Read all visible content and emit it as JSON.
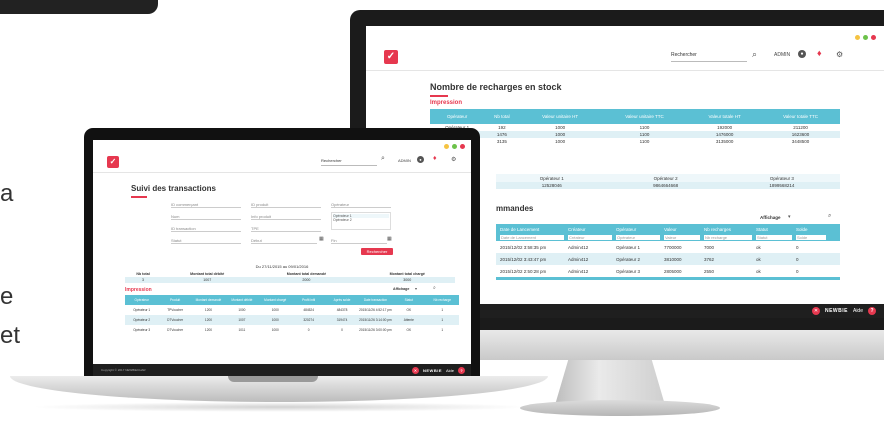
{
  "side_texts": [
    "a",
    "e",
    "et"
  ],
  "desktop": {
    "search_placeholder": "Rechercher",
    "user": "ADMIN",
    "title": "Nombre de recharges en stock",
    "print_label": "Impression",
    "stock_table": {
      "headers": [
        "Opérateur",
        "Nb total",
        "Valeur unitaire HT",
        "Valeur unitaire TTC",
        "Valeur totale HT",
        "Valeur totale TTC"
      ],
      "rows": [
        [
          "Opérateur 1",
          "192",
          "1000",
          "1100",
          "192000",
          "211200"
        ],
        [
          "Opérateur 2",
          "1476",
          "1000",
          "1100",
          "1476000",
          "1623600"
        ],
        [
          "",
          "3135",
          "1000",
          "1100",
          "3135000",
          "3448500"
        ]
      ]
    },
    "summary": {
      "headers": [
        "Opérateur 1",
        "Opérateur 2",
        "Opérateur 3"
      ],
      "values": [
        "12528046",
        "9864664668",
        "1899568214"
      ]
    },
    "orders": {
      "title": "mmandes",
      "display_label": "Affichage",
      "headers": [
        "Date de Lancement",
        "Créateur",
        "Opérateur",
        "Valeur",
        "Nb recharges",
        "Statut",
        "Solde"
      ],
      "filter_placeholders": [
        "Date de Lancement",
        "Créateur",
        "Opérateur",
        "Valeur",
        "Nb recharge",
        "Statut",
        "Solde"
      ],
      "rows": [
        [
          "2015/12/02 3:58:35 pm",
          "Admin412",
          "Opérateur 1",
          "7700000",
          "7000",
          "ok",
          "0"
        ],
        [
          "2015/12/02 3:43:47 pm",
          "Admin412",
          "Opérateur 2",
          "3810000",
          "3762",
          "ok",
          "0"
        ],
        [
          "2015/12/02 2:50:28 pm",
          "Admin412",
          "Opérateur 3",
          "2805000",
          "2550",
          "ok",
          "0"
        ]
      ]
    },
    "footer": {
      "brand": "NEWBIE",
      "help": "Aide"
    }
  },
  "laptop": {
    "search_placeholder": "Rechercher",
    "user": "ADMIN",
    "title": "Suivi des transactions",
    "filters": {
      "commercant": "ID commerçant",
      "produit": "ID produit",
      "operateur": "Opérateur",
      "numero": "Num",
      "info": "Info produit",
      "transaction": "ID transaction",
      "tpe": "TPE",
      "statut": "Statut",
      "debut": "Début",
      "fin": "Fin",
      "op_options": [
        "Opérateur 1",
        "Opérateur 2"
      ]
    },
    "search_button": "Rechercher",
    "period": "Du 27/11/2015 au 09/01/2016",
    "totals": {
      "headers": [
        "Nb total",
        "Montant total débité",
        "Montant total demandé",
        "Montant total chargé"
      ],
      "values": [
        "3",
        "1007",
        "2000",
        "3000"
      ]
    },
    "print_label": "Impression",
    "display_label": "Affichage",
    "tx_table": {
      "headers": [
        "Opérateur",
        "Produit",
        "Montant demandé",
        "Montant débité",
        "Montant chargé",
        "Profit initi",
        "Après solde",
        "Date transaction",
        "Statut",
        "Nb recharge"
      ],
      "rows": [
        [
          "Opérateur 1",
          "TPVoucher",
          "1200",
          "1000",
          "1000",
          "484524",
          "484378",
          "2015/11/26 4:52:17 pm",
          "OK",
          "1"
        ],
        [
          "Opérateur 2",
          "DTVoucher",
          "1200",
          "1007",
          "1000",
          "320274",
          "319474",
          "2015/11/26 3:14:00 pm",
          "Attente",
          "1"
        ],
        [
          "Opérateur 3",
          "DTVoucher",
          "1200",
          "1011",
          "1000",
          "0",
          "0",
          "2015/11/26 3:00:00 pm",
          "OK",
          "1"
        ]
      ]
    },
    "copyright": "Copyright © 2017 NEWBIECHAR",
    "footer": {
      "brand": "NEWBIE",
      "help": "Aide"
    }
  },
  "colors": {
    "accent": "#e6384f",
    "table_header": "#5bc0d4",
    "row_alt": "#dff0f5",
    "dark": "#1f1f1f"
  }
}
